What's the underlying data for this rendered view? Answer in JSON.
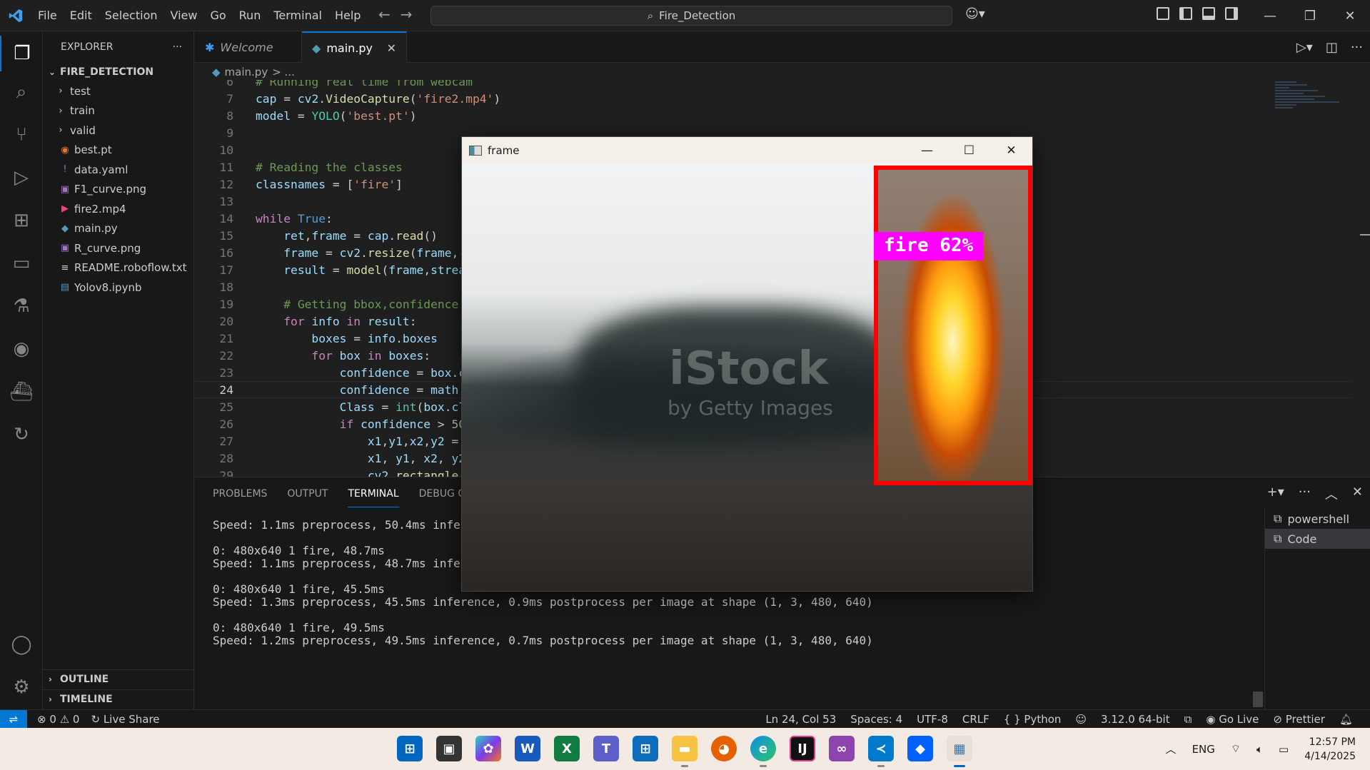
{
  "titlebar": {
    "menu": [
      "File",
      "Edit",
      "Selection",
      "View",
      "Go",
      "Run",
      "Terminal",
      "Help"
    ],
    "search": "Fire_Detection"
  },
  "sidebar": {
    "title": "EXPLORER",
    "more": "···",
    "folder": "FIRE_DETECTION",
    "items": [
      {
        "label": "test",
        "icon": "chevron-right",
        "color": "#cccccc"
      },
      {
        "label": "train",
        "icon": "chevron-right",
        "color": "#cccccc"
      },
      {
        "label": "valid",
        "icon": "chevron-right",
        "color": "#cccccc"
      },
      {
        "label": "best.pt",
        "icon": "rss-icon",
        "color": "#e37933"
      },
      {
        "label": "data.yaml",
        "icon": "exclamation-icon",
        "color": "#a074c4"
      },
      {
        "label": "F1_curve.png",
        "icon": "image-icon",
        "color": "#a074c4"
      },
      {
        "label": "fire2.mp4",
        "icon": "media-icon",
        "color": "#e8467c"
      },
      {
        "label": "main.py",
        "icon": "python-icon",
        "color": "#519aba"
      },
      {
        "label": "R_curve.png",
        "icon": "image-icon",
        "color": "#a074c4"
      },
      {
        "label": "README.roboflow.txt",
        "icon": "text-icon",
        "color": "#cccccc"
      },
      {
        "label": "Yolov8.ipynb",
        "icon": "notebook-icon",
        "color": "#519aba"
      }
    ],
    "outline": "OUTLINE",
    "timeline": "TIMELINE"
  },
  "tabs": {
    "welcome": "Welcome",
    "main": "main.py"
  },
  "breadcrumb": {
    "file": "main.py",
    "rest": "> ..."
  },
  "code": {
    "lines": [
      "6",
      "7",
      "8",
      "9",
      "10",
      "11",
      "12",
      "13",
      "14",
      "15",
      "16",
      "17",
      "18",
      "19",
      "20",
      "21",
      "22",
      "23",
      "24",
      "25",
      "26",
      "27",
      "28",
      "29"
    ],
    "current_line": "24"
  },
  "panel": {
    "tabs": [
      "PROBLEMS",
      "OUTPUT",
      "TERMINAL",
      "DEBUG CONSOLE"
    ],
    "active_tab": "TERMINAL",
    "terminal_lines": [
      "Speed: 1.1ms preprocess, 50.4ms inference, 0.8ms postprocess per image at shape (1, 3, 480, 640)",
      "",
      "0: 480x640 1 fire, 48.7ms",
      "Speed: 1.1ms preprocess, 48.7ms inference, 0.8ms postprocess per image at shape (1, 3, 480, 640)",
      "",
      "0: 480x640 1 fire, 45.5ms",
      "Speed: 1.3ms preprocess, 45.5ms inference, 0.9ms postprocess per image at shape (1, 3, 480, 640)",
      "",
      "0: 480x640 1 fire, 49.5ms",
      "Speed: 1.2ms preprocess, 49.5ms inference, 0.7ms postprocess per image at shape (1, 3, 480, 640)"
    ],
    "terminals": [
      "powershell",
      "Code"
    ]
  },
  "statusbar": {
    "errors": "0",
    "warnings": "0",
    "live_share": "Live Share",
    "position": "Ln 24, Col 53",
    "spaces": "Spaces: 4",
    "encoding": "UTF-8",
    "eol": "CRLF",
    "language": "Python",
    "interpreter": "3.12.0 64-bit",
    "go_live": "Go Live",
    "prettier": "Prettier"
  },
  "frame_window": {
    "title": "frame",
    "label": "fire 62%",
    "watermark": "iStock",
    "watermark_sub": "by Getty Images"
  },
  "taskbar": {
    "lang": "ENG",
    "time": "12:57 PM",
    "date": "4/14/2025"
  },
  "colors": {
    "accent": "#0078d4",
    "bbox": "#ff0000",
    "label_bg": "#ff00ff"
  }
}
